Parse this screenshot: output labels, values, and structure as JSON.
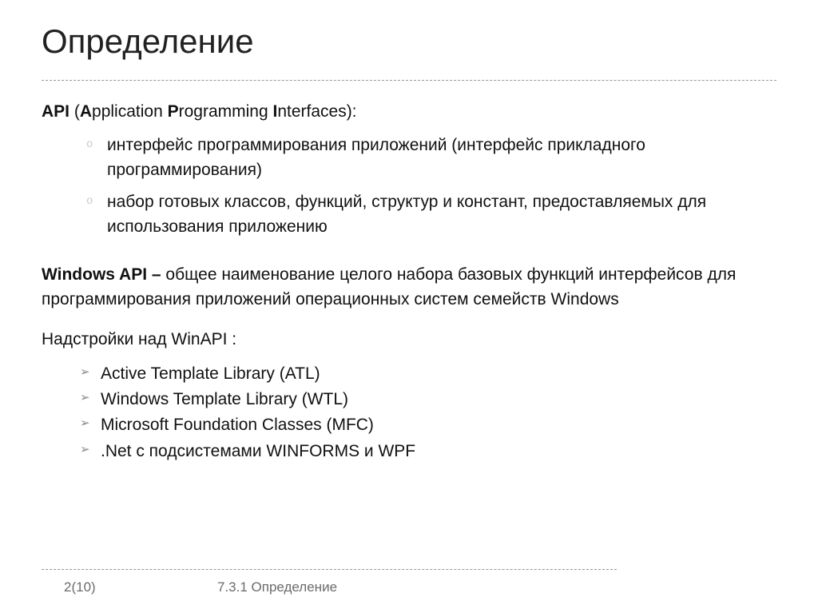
{
  "title": "Определение",
  "api_label": "API",
  "api_expansion_open": " (",
  "api_expansion_A": "A",
  "api_expansion_application": "pplication ",
  "api_expansion_P": "P",
  "api_expansion_programming": "rogramming ",
  "api_expansion_I": "I",
  "api_expansion_interfaces": "nterfaces):",
  "bullets_o": [
    "интерфейс программирования приложений (интерфейс прикладного программирования)",
    "набор готовых классов, функций, структур и констант, предоставляемых для использования приложению"
  ],
  "winapi_label": "Windows API – ",
  "winapi_text": "общее наименование целого набора базовых функций интерфейсов для программирования приложений операционных систем семейств Windows",
  "addons_title": "Надстройки над WinAPI :",
  "addons": [
    "Active Template Library (ATL)",
    "Windows Template Library (WTL)",
    "Microsoft Foundation Classes (MFC)",
    ".Net с подсистемами WINFORMS и WPF"
  ],
  "footer": {
    "page": "2(10)",
    "section": "7.3.1 Определение"
  }
}
